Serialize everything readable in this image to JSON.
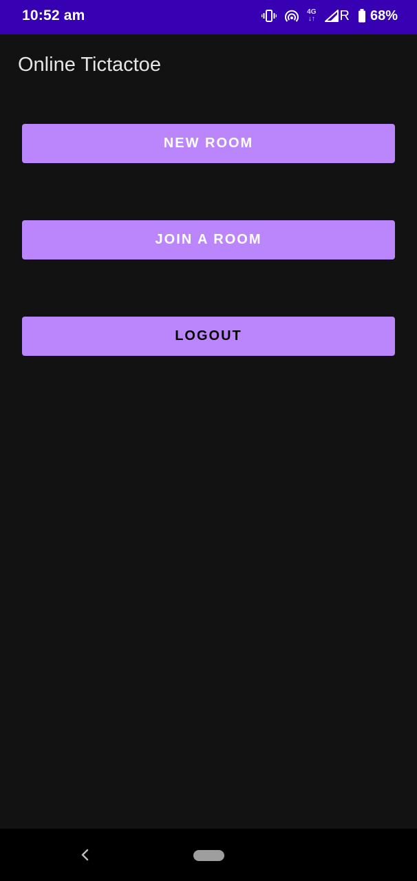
{
  "status_bar": {
    "time": "10:52 am",
    "network_type": "4G",
    "roaming": "R",
    "battery_percent": "68%",
    "icons": [
      "vibrate-icon",
      "hotspot-icon",
      "network-4g-icon",
      "signal-icon",
      "battery-icon"
    ],
    "background_color": "#3700b3"
  },
  "app_bar": {
    "title": "Online Tictactoe"
  },
  "buttons": {
    "new_room": "NEW ROOM",
    "join_room": "JOIN A ROOM",
    "logout": "LOGOUT"
  },
  "colors": {
    "background": "#121212",
    "button_accent": "#bb86fc"
  },
  "nav_bar": {
    "icons": [
      "back-icon",
      "home-pill-icon"
    ]
  }
}
